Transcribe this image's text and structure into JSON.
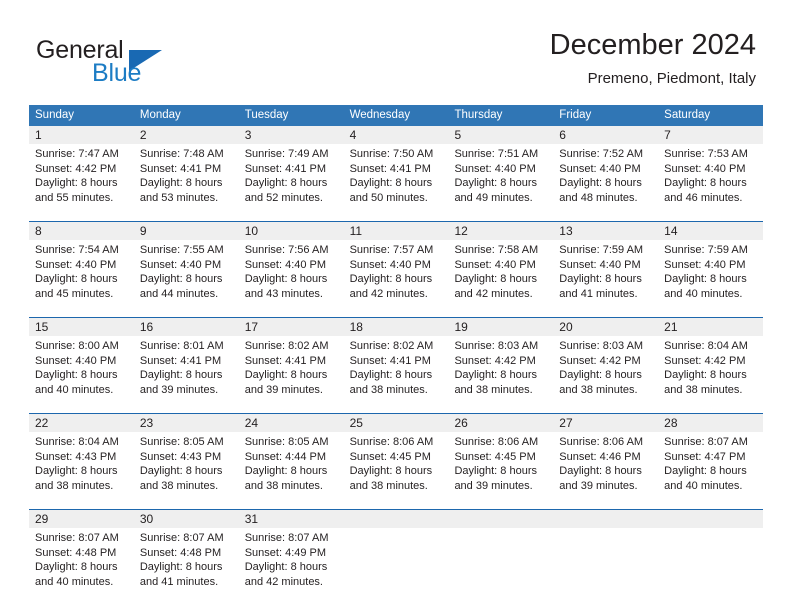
{
  "brand": {
    "word1": "General",
    "word2": "Blue",
    "accent_color": "#1c7cc4",
    "flag_color": "#1969b3"
  },
  "header": {
    "title": "December 2024",
    "subtitle": "Premeno, Piedmont, Italy"
  },
  "theme": {
    "header_blue": "#3076b5",
    "rule_blue": "#1d67ad",
    "number_band": "#efefef",
    "text": "#231f20"
  },
  "weekdays": [
    "Sunday",
    "Monday",
    "Tuesday",
    "Wednesday",
    "Thursday",
    "Friday",
    "Saturday"
  ],
  "weeks": [
    {
      "days": [
        {
          "num": "1",
          "sunrise": "Sunrise: 7:47 AM",
          "sunset": "Sunset: 4:42 PM",
          "daylight1": "Daylight: 8 hours",
          "daylight2": "and 55 minutes."
        },
        {
          "num": "2",
          "sunrise": "Sunrise: 7:48 AM",
          "sunset": "Sunset: 4:41 PM",
          "daylight1": "Daylight: 8 hours",
          "daylight2": "and 53 minutes."
        },
        {
          "num": "3",
          "sunrise": "Sunrise: 7:49 AM",
          "sunset": "Sunset: 4:41 PM",
          "daylight1": "Daylight: 8 hours",
          "daylight2": "and 52 minutes."
        },
        {
          "num": "4",
          "sunrise": "Sunrise: 7:50 AM",
          "sunset": "Sunset: 4:41 PM",
          "daylight1": "Daylight: 8 hours",
          "daylight2": "and 50 minutes."
        },
        {
          "num": "5",
          "sunrise": "Sunrise: 7:51 AM",
          "sunset": "Sunset: 4:40 PM",
          "daylight1": "Daylight: 8 hours",
          "daylight2": "and 49 minutes."
        },
        {
          "num": "6",
          "sunrise": "Sunrise: 7:52 AM",
          "sunset": "Sunset: 4:40 PM",
          "daylight1": "Daylight: 8 hours",
          "daylight2": "and 48 minutes."
        },
        {
          "num": "7",
          "sunrise": "Sunrise: 7:53 AM",
          "sunset": "Sunset: 4:40 PM",
          "daylight1": "Daylight: 8 hours",
          "daylight2": "and 46 minutes."
        }
      ]
    },
    {
      "days": [
        {
          "num": "8",
          "sunrise": "Sunrise: 7:54 AM",
          "sunset": "Sunset: 4:40 PM",
          "daylight1": "Daylight: 8 hours",
          "daylight2": "and 45 minutes."
        },
        {
          "num": "9",
          "sunrise": "Sunrise: 7:55 AM",
          "sunset": "Sunset: 4:40 PM",
          "daylight1": "Daylight: 8 hours",
          "daylight2": "and 44 minutes."
        },
        {
          "num": "10",
          "sunrise": "Sunrise: 7:56 AM",
          "sunset": "Sunset: 4:40 PM",
          "daylight1": "Daylight: 8 hours",
          "daylight2": "and 43 minutes."
        },
        {
          "num": "11",
          "sunrise": "Sunrise: 7:57 AM",
          "sunset": "Sunset: 4:40 PM",
          "daylight1": "Daylight: 8 hours",
          "daylight2": "and 42 minutes."
        },
        {
          "num": "12",
          "sunrise": "Sunrise: 7:58 AM",
          "sunset": "Sunset: 4:40 PM",
          "daylight1": "Daylight: 8 hours",
          "daylight2": "and 42 minutes."
        },
        {
          "num": "13",
          "sunrise": "Sunrise: 7:59 AM",
          "sunset": "Sunset: 4:40 PM",
          "daylight1": "Daylight: 8 hours",
          "daylight2": "and 41 minutes."
        },
        {
          "num": "14",
          "sunrise": "Sunrise: 7:59 AM",
          "sunset": "Sunset: 4:40 PM",
          "daylight1": "Daylight: 8 hours",
          "daylight2": "and 40 minutes."
        }
      ]
    },
    {
      "days": [
        {
          "num": "15",
          "sunrise": "Sunrise: 8:00 AM",
          "sunset": "Sunset: 4:40 PM",
          "daylight1": "Daylight: 8 hours",
          "daylight2": "and 40 minutes."
        },
        {
          "num": "16",
          "sunrise": "Sunrise: 8:01 AM",
          "sunset": "Sunset: 4:41 PM",
          "daylight1": "Daylight: 8 hours",
          "daylight2": "and 39 minutes."
        },
        {
          "num": "17",
          "sunrise": "Sunrise: 8:02 AM",
          "sunset": "Sunset: 4:41 PM",
          "daylight1": "Daylight: 8 hours",
          "daylight2": "and 39 minutes."
        },
        {
          "num": "18",
          "sunrise": "Sunrise: 8:02 AM",
          "sunset": "Sunset: 4:41 PM",
          "daylight1": "Daylight: 8 hours",
          "daylight2": "and 38 minutes."
        },
        {
          "num": "19",
          "sunrise": "Sunrise: 8:03 AM",
          "sunset": "Sunset: 4:42 PM",
          "daylight1": "Daylight: 8 hours",
          "daylight2": "and 38 minutes."
        },
        {
          "num": "20",
          "sunrise": "Sunrise: 8:03 AM",
          "sunset": "Sunset: 4:42 PM",
          "daylight1": "Daylight: 8 hours",
          "daylight2": "and 38 minutes."
        },
        {
          "num": "21",
          "sunrise": "Sunrise: 8:04 AM",
          "sunset": "Sunset: 4:42 PM",
          "daylight1": "Daylight: 8 hours",
          "daylight2": "and 38 minutes."
        }
      ]
    },
    {
      "days": [
        {
          "num": "22",
          "sunrise": "Sunrise: 8:04 AM",
          "sunset": "Sunset: 4:43 PM",
          "daylight1": "Daylight: 8 hours",
          "daylight2": "and 38 minutes."
        },
        {
          "num": "23",
          "sunrise": "Sunrise: 8:05 AM",
          "sunset": "Sunset: 4:43 PM",
          "daylight1": "Daylight: 8 hours",
          "daylight2": "and 38 minutes."
        },
        {
          "num": "24",
          "sunrise": "Sunrise: 8:05 AM",
          "sunset": "Sunset: 4:44 PM",
          "daylight1": "Daylight: 8 hours",
          "daylight2": "and 38 minutes."
        },
        {
          "num": "25",
          "sunrise": "Sunrise: 8:06 AM",
          "sunset": "Sunset: 4:45 PM",
          "daylight1": "Daylight: 8 hours",
          "daylight2": "and 38 minutes."
        },
        {
          "num": "26",
          "sunrise": "Sunrise: 8:06 AM",
          "sunset": "Sunset: 4:45 PM",
          "daylight1": "Daylight: 8 hours",
          "daylight2": "and 39 minutes."
        },
        {
          "num": "27",
          "sunrise": "Sunrise: 8:06 AM",
          "sunset": "Sunset: 4:46 PM",
          "daylight1": "Daylight: 8 hours",
          "daylight2": "and 39 minutes."
        },
        {
          "num": "28",
          "sunrise": "Sunrise: 8:07 AM",
          "sunset": "Sunset: 4:47 PM",
          "daylight1": "Daylight: 8 hours",
          "daylight2": "and 40 minutes."
        }
      ]
    },
    {
      "days": [
        {
          "num": "29",
          "sunrise": "Sunrise: 8:07 AM",
          "sunset": "Sunset: 4:48 PM",
          "daylight1": "Daylight: 8 hours",
          "daylight2": "and 40 minutes."
        },
        {
          "num": "30",
          "sunrise": "Sunrise: 8:07 AM",
          "sunset": "Sunset: 4:48 PM",
          "daylight1": "Daylight: 8 hours",
          "daylight2": "and 41 minutes."
        },
        {
          "num": "31",
          "sunrise": "Sunrise: 8:07 AM",
          "sunset": "Sunset: 4:49 PM",
          "daylight1": "Daylight: 8 hours",
          "daylight2": "and 42 minutes."
        },
        {
          "num": "",
          "sunrise": "",
          "sunset": "",
          "daylight1": "",
          "daylight2": ""
        },
        {
          "num": "",
          "sunrise": "",
          "sunset": "",
          "daylight1": "",
          "daylight2": ""
        },
        {
          "num": "",
          "sunrise": "",
          "sunset": "",
          "daylight1": "",
          "daylight2": ""
        },
        {
          "num": "",
          "sunrise": "",
          "sunset": "",
          "daylight1": "",
          "daylight2": ""
        }
      ]
    }
  ]
}
